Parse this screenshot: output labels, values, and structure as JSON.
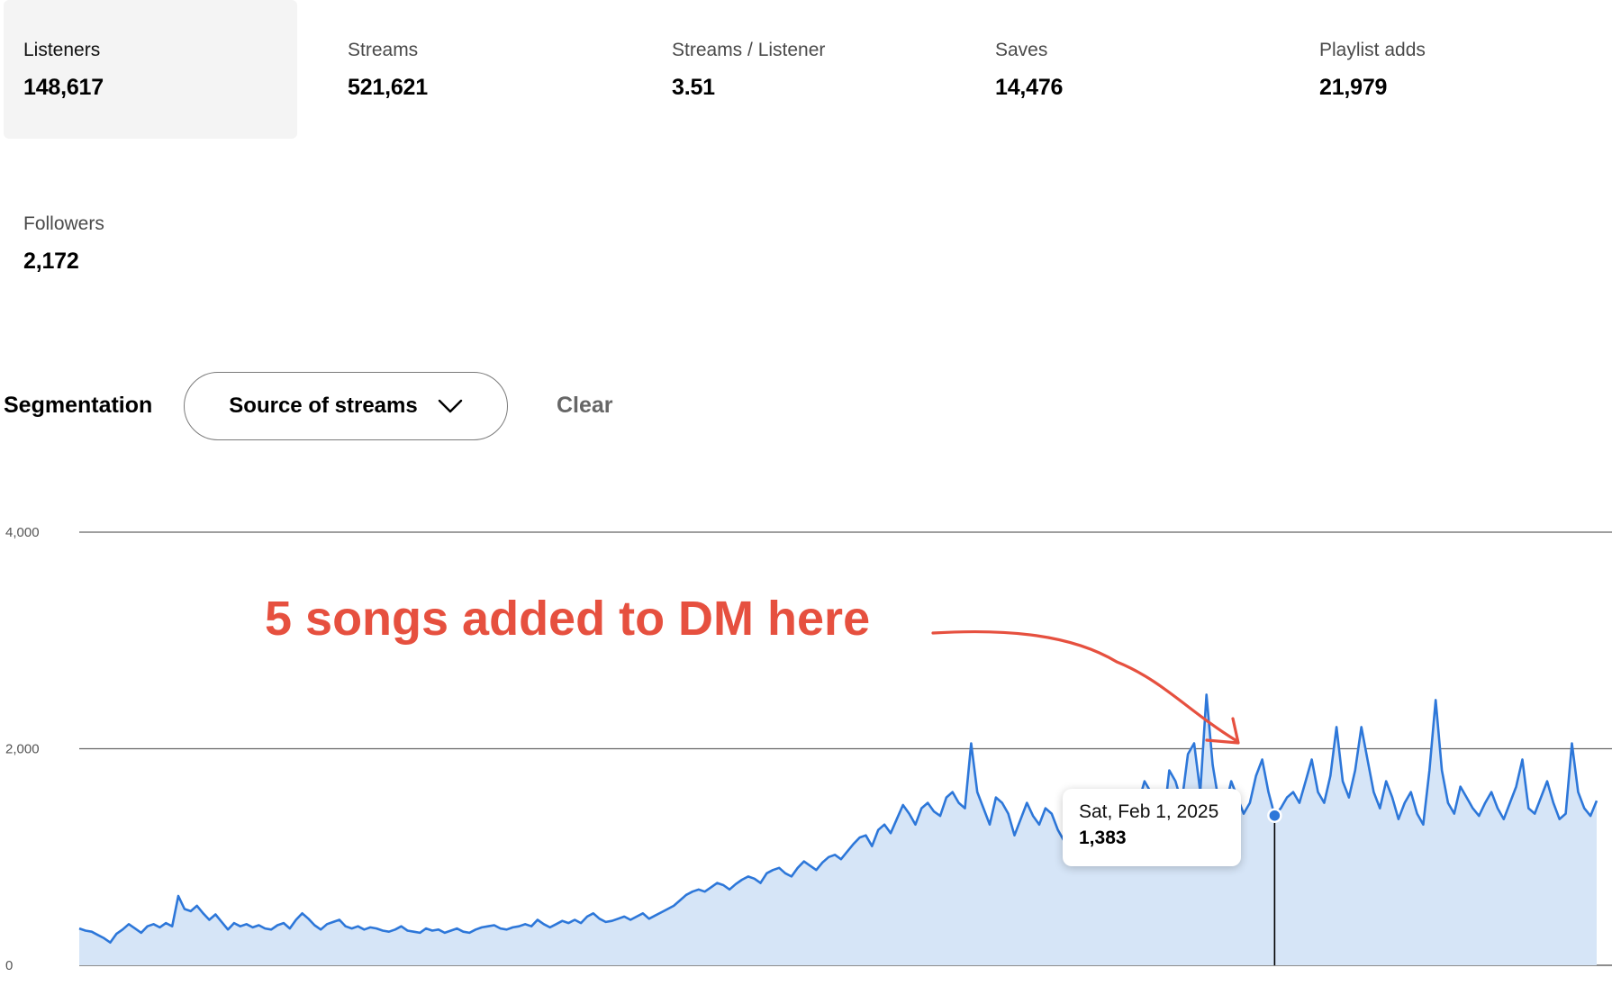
{
  "metrics": [
    {
      "label": "Listeners",
      "value": "148,617",
      "active": true
    },
    {
      "label": "Streams",
      "value": "521,621",
      "active": false
    },
    {
      "label": "Streams / Listener",
      "value": "3.51",
      "active": false
    },
    {
      "label": "Saves",
      "value": "14,476",
      "active": false
    },
    {
      "label": "Playlist adds",
      "value": "21,979",
      "active": false
    },
    {
      "label": "Followers",
      "value": "2,172",
      "active": false
    }
  ],
  "segmentation": {
    "label": "Segmentation",
    "selected": "Source of streams",
    "clear_label": "Clear"
  },
  "tooltip": {
    "date": "Sat, Feb 1, 2025",
    "value": "1,383"
  },
  "annotation": {
    "text": "5 songs added to DM here",
    "color": "#e6503f"
  },
  "colors": {
    "line": "#2d77d9",
    "area": "#d6e5f7",
    "grid": "#666666",
    "marker_line": "#000000"
  },
  "icons": {
    "dropdown": "chevron-down-icon"
  },
  "chart_data": {
    "type": "area",
    "title": "",
    "xlabel": "",
    "ylabel": "",
    "ylim": [
      0,
      4000
    ],
    "yticks": [
      0,
      2000,
      4000
    ],
    "ytick_labels": [
      "0",
      "2,000",
      "4,000"
    ],
    "grid": true,
    "highlight": {
      "label": "Sat, Feb 1, 2025",
      "value": 1383
    },
    "series": [
      {
        "values": [
          340,
          320,
          310,
          280,
          250,
          210,
          290,
          330,
          380,
          340,
          300,
          360,
          380,
          350,
          390,
          360,
          640,
          520,
          500,
          550,
          480,
          420,
          470,
          400,
          330,
          390,
          360,
          380,
          350,
          370,
          340,
          330,
          370,
          390,
          340,
          420,
          480,
          430,
          370,
          330,
          380,
          400,
          420,
          360,
          340,
          360,
          330,
          350,
          340,
          320,
          310,
          330,
          360,
          320,
          310,
          300,
          340,
          320,
          330,
          300,
          320,
          340,
          310,
          300,
          330,
          350,
          360,
          370,
          340,
          330,
          350,
          360,
          380,
          360,
          420,
          380,
          350,
          380,
          410,
          390,
          420,
          390,
          450,
          480,
          430,
          400,
          410,
          430,
          450,
          420,
          450,
          480,
          430,
          460,
          490,
          520,
          550,
          600,
          650,
          680,
          700,
          680,
          720,
          760,
          740,
          700,
          750,
          790,
          820,
          800,
          760,
          850,
          880,
          900,
          850,
          820,
          900,
          960,
          920,
          880,
          950,
          1000,
          1020,
          980,
          1050,
          1120,
          1180,
          1200,
          1100,
          1250,
          1300,
          1220,
          1350,
          1480,
          1400,
          1300,
          1450,
          1500,
          1420,
          1380,
          1550,
          1600,
          1500,
          1450,
          2050,
          1600,
          1450,
          1300,
          1550,
          1500,
          1400,
          1200,
          1350,
          1500,
          1380,
          1300,
          1450,
          1400,
          1250,
          1150,
          1050,
          1100,
          1200,
          1300,
          1250,
          1350,
          1200,
          1150,
          1300,
          1400,
          1350,
          1500,
          1700,
          1600,
          1450,
          1300,
          1800,
          1700,
          1500,
          1950,
          2050,
          1600,
          2500,
          1850,
          1500,
          1450,
          1700,
          1550,
          1400,
          1500,
          1750,
          1900,
          1600,
          1383,
          1450,
          1550,
          1600,
          1500,
          1700,
          1900,
          1600,
          1500,
          1750,
          2200,
          1700,
          1550,
          1800,
          2200,
          1900,
          1600,
          1450,
          1700,
          1550,
          1350,
          1500,
          1600,
          1400,
          1300,
          1800,
          2450,
          1800,
          1500,
          1400,
          1650,
          1550,
          1450,
          1380,
          1500,
          1600,
          1450,
          1350,
          1500,
          1650,
          1900,
          1450,
          1400,
          1550,
          1700,
          1500,
          1350,
          1400,
          2050,
          1600,
          1450,
          1380,
          1520
        ]
      }
    ]
  }
}
